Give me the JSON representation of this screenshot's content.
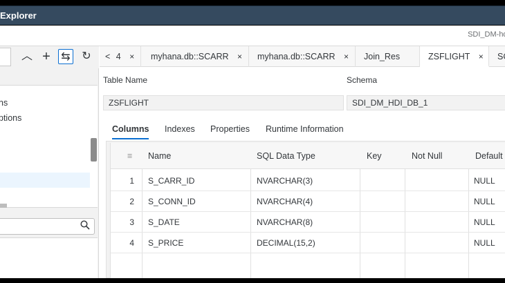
{
  "window": {
    "title": "Explorer"
  },
  "subheader": {
    "right_text": "SDI_DM-hdi"
  },
  "left_toolbar": {
    "buttons": [
      {
        "icon": "collapse-icon",
        "glyph": "︿"
      },
      {
        "icon": "plus-icon",
        "glyph": "+"
      },
      {
        "icon": "link-icon",
        "glyph": "⇆"
      },
      {
        "icon": "refresh-icon",
        "glyph": "↻"
      }
    ]
  },
  "tree": {
    "items": [
      "ns",
      "ptions"
    ]
  },
  "tabs": {
    "back_glyph": "<",
    "overflow_count": "4",
    "items": [
      {
        "label": "myhana.db::SCARR"
      },
      {
        "label": "myhana.db::SCARR"
      },
      {
        "label": "Join_Res"
      },
      {
        "label": "ZSFLIGHT"
      },
      {
        "label": "SC"
      }
    ],
    "close_glyph": "×"
  },
  "form": {
    "table_name_label": "Table Name",
    "table_name_value": "ZSFLIGHT",
    "schema_label": "Schema",
    "schema_value": "SDI_DM_HDI_DB_1"
  },
  "inner_tabs": [
    "Columns",
    "Indexes",
    "Properties",
    "Runtime Information"
  ],
  "grid": {
    "sort_glyph": "≡",
    "headers": [
      "Name",
      "SQL Data Type",
      "Key",
      "Not Null",
      "Default"
    ],
    "rows": [
      {
        "num": "1",
        "name": "S_CARR_ID",
        "type": "NVARCHAR(3)",
        "key": "",
        "notnull": "",
        "default": "NULL"
      },
      {
        "num": "2",
        "name": "S_CONN_ID",
        "type": "NVARCHAR(4)",
        "key": "",
        "notnull": "",
        "default": "NULL"
      },
      {
        "num": "3",
        "name": "S_DATE",
        "type": "NVARCHAR(8)",
        "key": "",
        "notnull": "",
        "default": "NULL"
      },
      {
        "num": "4",
        "name": "S_PRICE",
        "type": "DECIMAL(15,2)",
        "key": "",
        "notnull": "",
        "default": "NULL"
      }
    ]
  },
  "colors": {
    "accent": "#0a6ed1",
    "titlebar": "#354a5f"
  }
}
